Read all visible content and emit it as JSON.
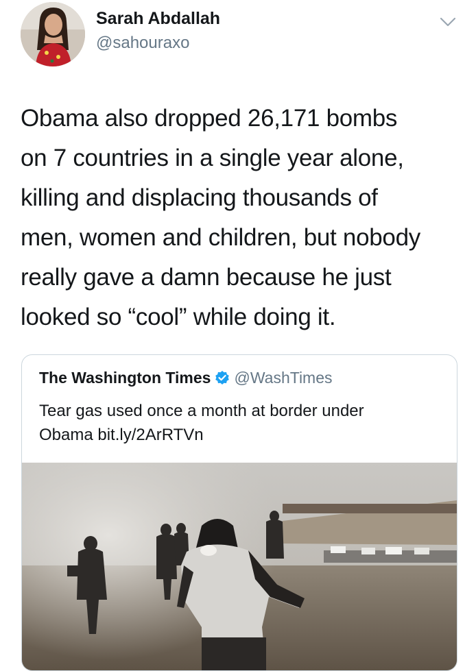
{
  "tweet": {
    "author_name": "Sarah Abdallah",
    "author_handle": "@sahouraxo",
    "lines": [
      "Obama also dropped 26,171 bombs",
      "on 7 countries in a single year alone,",
      "killing and displacing thousands of",
      "men, women and children, but nobody",
      "really gave a damn because he just",
      "looked so “cool” while doing it."
    ]
  },
  "quoted_tweet": {
    "author_name": "The Washington Times",
    "author_handle": "@WashTimes",
    "verified": true,
    "lines": [
      "Tear gas used once a month at border under",
      "Obama bit.ly/2ArRTVn"
    ]
  },
  "icons": {
    "menu": "chevron-down-icon",
    "verified": "verified-badge-icon"
  },
  "colors": {
    "text": "#14171a",
    "secondary": "#657786",
    "verified": "#1da1f2",
    "border": "#ccd6dd"
  }
}
